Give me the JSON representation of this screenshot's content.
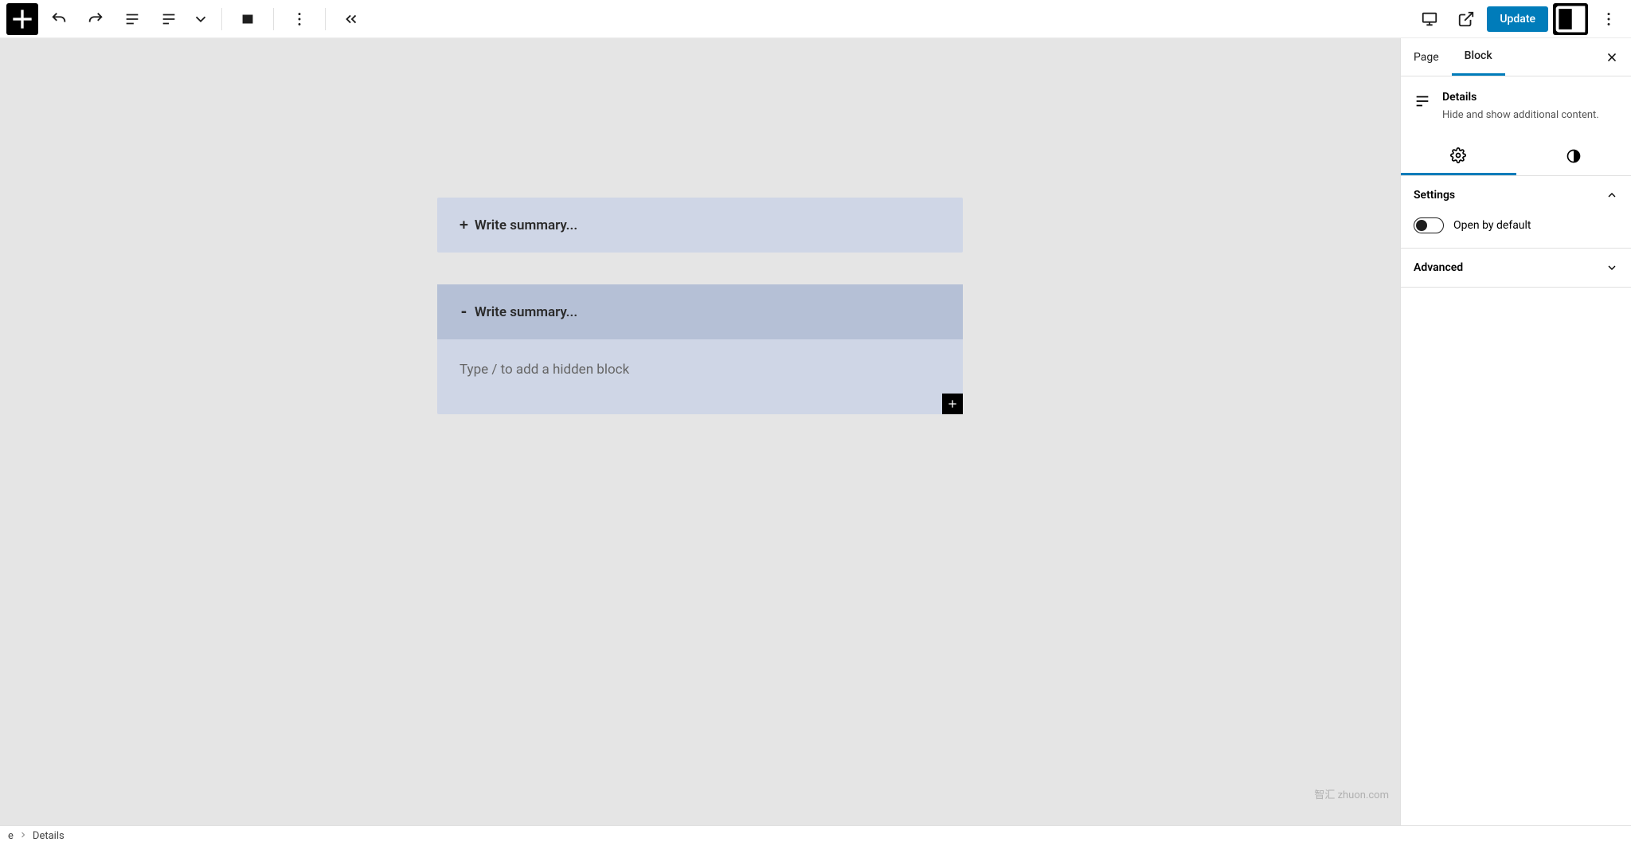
{
  "toolbar": {
    "update_label": "Update"
  },
  "editor": {
    "closed_block": {
      "summary_placeholder": "Write summary..."
    },
    "open_block": {
      "summary_placeholder": "Write summary...",
      "body_placeholder": "Type / to add a hidden block"
    }
  },
  "sidebar": {
    "tabs": {
      "page": "Page",
      "block": "Block"
    },
    "block": {
      "name": "Details",
      "description": "Hide and show additional content."
    },
    "panels": {
      "settings": {
        "title": "Settings",
        "open_by_default": "Open by default"
      },
      "advanced": {
        "title": "Advanced"
      }
    }
  },
  "breadcrumb": {
    "parent": "e",
    "current": "Details"
  },
  "watermark": "智汇 zhuon.com"
}
